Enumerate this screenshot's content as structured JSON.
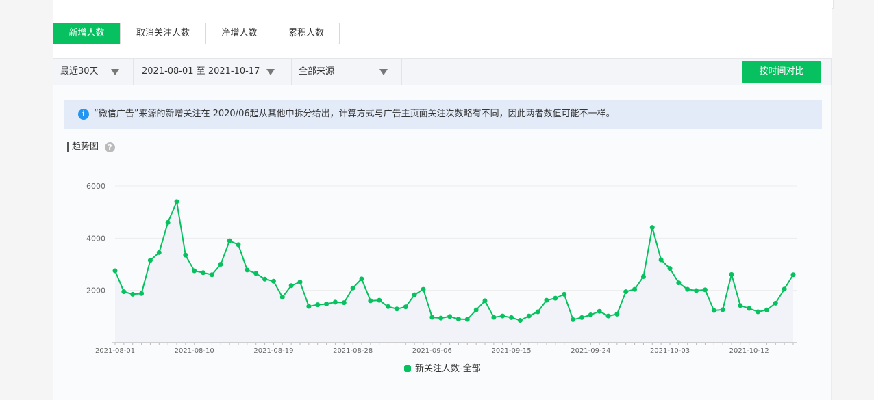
{
  "tabs": [
    {
      "label": "新增人数",
      "active": true
    },
    {
      "label": "取消关注人数",
      "active": false
    },
    {
      "label": "净增人数",
      "active": false
    },
    {
      "label": "累积人数",
      "active": false
    }
  ],
  "filters": {
    "period": "最近30天",
    "date_range": "2021-08-01 至 2021-10-17",
    "source": "全部来源",
    "compare_button": "按时间对比"
  },
  "notice": {
    "icon": "info-icon",
    "text": "“微信广告”来源的新增关注在 2020/06起从其他中拆分给出，计算方式与广告主页面关注次数略有不同，因此两者数值可能不一样。"
  },
  "section": {
    "title": "趋势图",
    "help_icon": "?"
  },
  "colors": {
    "accent": "#07c160",
    "notice_bg": "#e2ebf7"
  },
  "chart_data": {
    "type": "line",
    "ylim": [
      0,
      6000
    ],
    "yticks": [
      2000,
      4000,
      6000
    ],
    "tick_labels_x": [
      "2021-08-01",
      "2021-08-10",
      "2021-08-19",
      "2021-08-28",
      "2021-09-06",
      "2021-09-15",
      "2021-09-24",
      "2021-10-03",
      "2021-10-12"
    ],
    "x_start": "2021-08-01",
    "x_end": "2021-10-17",
    "legend_position": "bottom",
    "grid": true,
    "series": [
      {
        "name": "新关注人数-全部",
        "color": "#07c160",
        "values": [
          2750,
          1950,
          1850,
          1880,
          3150,
          3450,
          4600,
          5400,
          3350,
          2750,
          2680,
          2600,
          3000,
          3900,
          3750,
          2780,
          2650,
          2430,
          2350,
          1740,
          2180,
          2320,
          1390,
          1450,
          1480,
          1550,
          1530,
          2090,
          2440,
          1600,
          1620,
          1380,
          1290,
          1370,
          1830,
          2040,
          970,
          940,
          1000,
          900,
          890,
          1250,
          1600,
          970,
          1020,
          960,
          850,
          1020,
          1180,
          1620,
          1700,
          1850,
          880,
          960,
          1060,
          1200,
          1020,
          1090,
          1950,
          2040,
          2530,
          4410,
          3170,
          2840,
          2290,
          2040,
          1990,
          2020,
          1230,
          1260,
          2610,
          1420,
          1310,
          1180,
          1250,
          1510,
          2050,
          2600
        ]
      }
    ]
  }
}
